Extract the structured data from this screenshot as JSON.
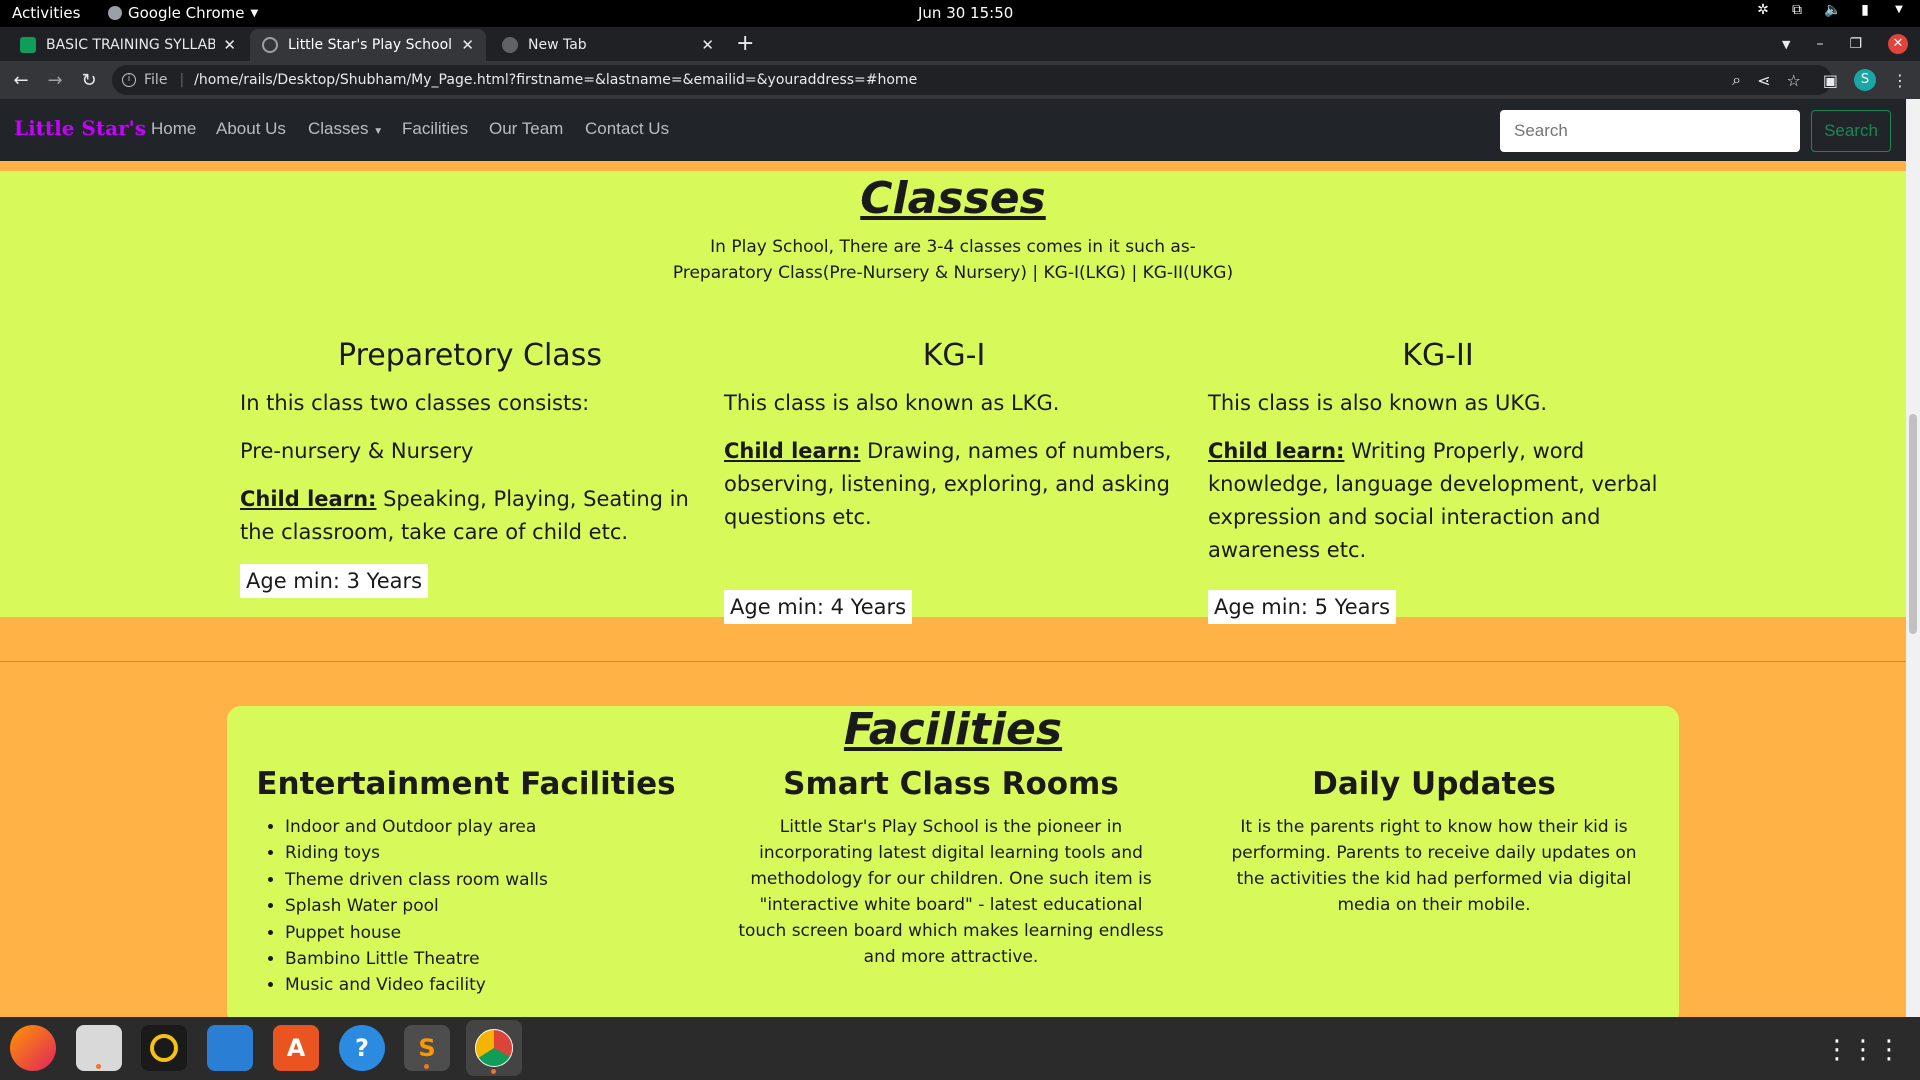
{
  "topbar": {
    "activities": "Activities",
    "app": "Google Chrome",
    "clock": "Jun 30  15:50"
  },
  "tabs": [
    {
      "title": "BASIC TRAINING SYLLABUS",
      "color": "#0f9d58"
    },
    {
      "title": "Little Star's Play School",
      "color": "#9aa0a6"
    },
    {
      "title": "New Tab",
      "color": "#5f6368"
    }
  ],
  "omnibox": {
    "scheme": "File",
    "url": "/home/rails/Desktop/Shubham/My_Page.html?firstname=&lastname=&emailid=&youraddress=#home"
  },
  "profile_initial": "S",
  "navbar": {
    "brand": "Little Star's",
    "links": [
      "Home",
      "About Us",
      "Classes",
      "Facilities",
      "Our Team",
      "Contact Us"
    ],
    "search_placeholder": "Search",
    "search_button": "Search"
  },
  "classes": {
    "title": "Classes",
    "intro_line1": "In Play School, There are 3-4 classes comes in it such as-",
    "intro_line2": "Preparatory Class(Pre-Nursery & Nursery) | KG-I(LKG) | KG-II(UKG)",
    "cols": [
      {
        "title": "Preparetory Class",
        "line1": "In this class two classes consists:",
        "line2": "Pre-nursery & Nursery",
        "learn_label": "Child learn:",
        "learn_text": " Speaking, Playing, Seating in the classroom, take care of child etc.",
        "age": "Age min: 3 Years"
      },
      {
        "title": "KG-I",
        "line1": "This class is also known as LKG.",
        "learn_label": "Child learn:",
        "learn_text": " Drawing, names of numbers, observing, listening, exploring, and asking questions etc.",
        "age": "Age min: 4 Years"
      },
      {
        "title": "KG-II",
        "line1": "This class is also known as UKG.",
        "learn_label": "Child learn:",
        "learn_text": " Writing Properly, word knowledge, language development, verbal expression and social interaction and awareness etc.",
        "age": "Age min: 5 Years"
      }
    ]
  },
  "facilities": {
    "title": "Facilities",
    "entertainment": {
      "title": "Entertainment Facilities",
      "items": [
        "Indoor and Outdoor play area",
        "Riding toys",
        "Theme driven class room walls",
        "Splash Water pool",
        "Puppet house",
        "Bambino Little Theatre",
        "Music and Video facility"
      ]
    },
    "smart": {
      "title": "Smart Class Rooms",
      "text": "Little Star's Play School is the pioneer in incorporating latest digital learning tools and methodology for our children. One such item is \"interactive white board\" - latest educational touch screen board which makes learning endless and more attractive."
    },
    "daily": {
      "title": "Daily Updates",
      "text": "It is the parents right to know how their kid is performing. Parents to receive daily updates on the activities the kid had performed via digital media on their mobile."
    }
  },
  "dock": [
    "firefox-icon",
    "files-icon",
    "rhythmbox-icon",
    "writer-icon",
    "software-icon",
    "help-icon",
    "sublime-icon",
    "chrome-icon"
  ]
}
